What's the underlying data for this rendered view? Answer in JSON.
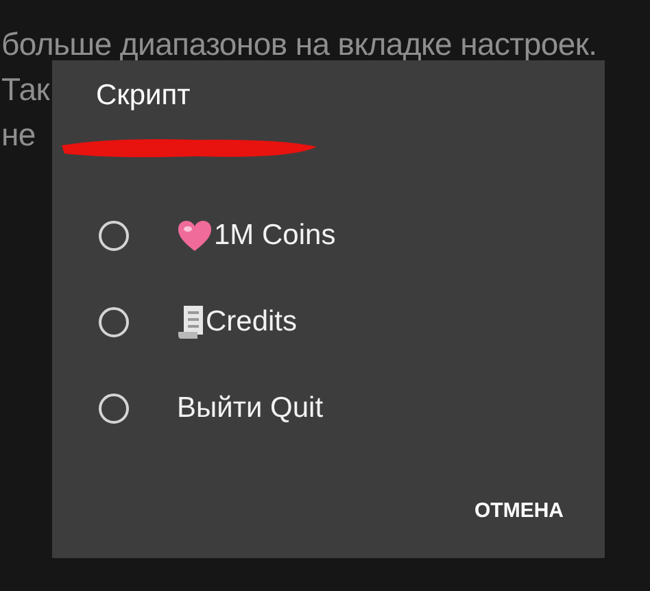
{
  "background_text": [
    "больше диапазонов на вкладке настроек.",
    "Так",
    "не"
  ],
  "dialog": {
    "title": "Скрипт",
    "redacted": true,
    "options": [
      {
        "kind": "heart",
        "label": "1M Coins",
        "selected": false
      },
      {
        "kind": "scroll",
        "label": "Credits",
        "selected": false
      },
      {
        "kind": "plain",
        "label": "Выйти Quit",
        "selected": false
      }
    ],
    "buttons": [
      "ОТМЕНА"
    ]
  }
}
